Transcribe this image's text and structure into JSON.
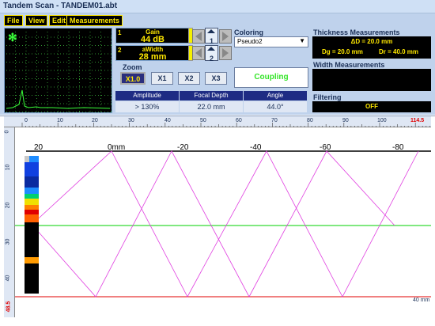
{
  "window": {
    "title": "Tandem Scan - TANDEM01.abt"
  },
  "menu": [
    {
      "label": "File"
    },
    {
      "label": "View"
    },
    {
      "label": "Edit"
    },
    {
      "label": "Measurements"
    }
  ],
  "gain": {
    "ch1_num": "1",
    "ch1_label": "Gain",
    "ch1_value": "44 dB",
    "ch2_num": "2",
    "ch2_label": "aWidth",
    "ch2_value": "28 mm",
    "up1": "1",
    "up2": "2"
  },
  "coloring": {
    "label": "Coloring",
    "value": "Pseudo2"
  },
  "zoom": {
    "label": "Zoom",
    "buttons": [
      {
        "label": "X1.0",
        "active": true
      },
      {
        "label": "X1"
      },
      {
        "label": "X2"
      },
      {
        "label": "X3"
      }
    ]
  },
  "coupling": {
    "label": "Coupling"
  },
  "table": {
    "headers": [
      "Amplitude",
      "Focal Depth",
      "Angle"
    ],
    "values": [
      "> 130%",
      "22.0 mm",
      "44.0°"
    ]
  },
  "thickness": {
    "label": "Thickness Measurements",
    "delta": "ΔD = 20.0 mm",
    "dg": "Dg = 20.0 mm",
    "dr": "Dr = 40.0 mm"
  },
  "width": {
    "label": "Width Measurements"
  },
  "filtering": {
    "label": "Filtering",
    "value": "OFF"
  },
  "hruler": {
    "ticks": [
      "0",
      "10",
      "20",
      "30",
      "40",
      "50",
      "60",
      "70",
      "80",
      "90",
      "100"
    ],
    "end": "114.5"
  },
  "vruler": {
    "ticks": [
      "0",
      "10",
      "20",
      "30",
      "40"
    ],
    "end": "48.5"
  },
  "scan": {
    "top_labels": [
      "20",
      "0mm",
      "-20",
      "-40",
      "-60",
      "-80"
    ],
    "depth_label": "40 mm"
  },
  "colors": {
    "accent_yellow": "#ffe800",
    "header_blue": "#1e2c84",
    "coupling_green": "#36e52a",
    "gate_green": "#00d000",
    "gate_red": "#e00000",
    "ray_magenta": "#e040e0"
  },
  "icons": {
    "freeze": "snowflake-icon"
  }
}
